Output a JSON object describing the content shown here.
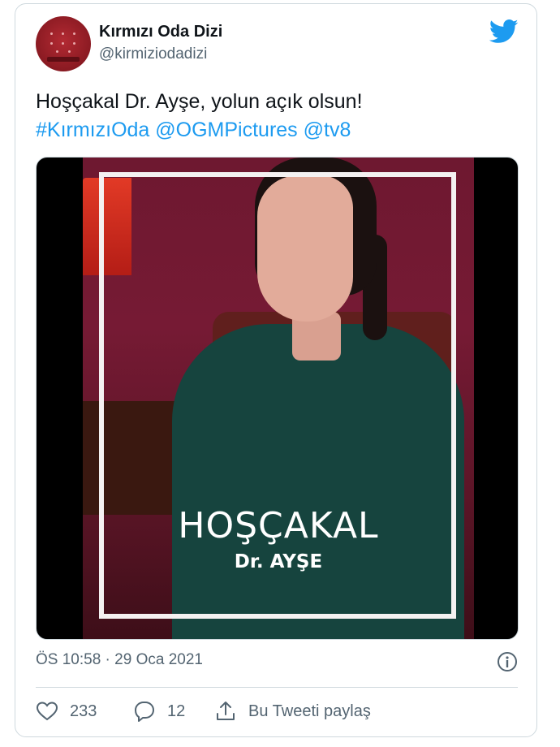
{
  "tweet": {
    "author": {
      "name": "Kırmızı Oda Dizi",
      "handle": "@kirmiziodadizi"
    },
    "text": "Hoşçakal Dr. Ayşe, yolun açık olsun!",
    "links": [
      "#KırmızıOda",
      "@OGMPictures",
      "@tv8"
    ],
    "media": {
      "overlay_title": "HOŞÇAKAL",
      "overlay_subtitle": "Dr. AYŞE"
    },
    "timestamp": "ÖS 10:58 · 29 Oca 2021",
    "actions": {
      "likes": "233",
      "replies": "12",
      "share_label": "Bu Tweeti paylaş"
    }
  },
  "colors": {
    "accent": "#1d9bf0",
    "text_secondary": "#536471",
    "border": "#cfd9de"
  },
  "icons": [
    "twitter-bird-icon",
    "info-icon",
    "heart-icon",
    "reply-icon",
    "share-icon"
  ]
}
